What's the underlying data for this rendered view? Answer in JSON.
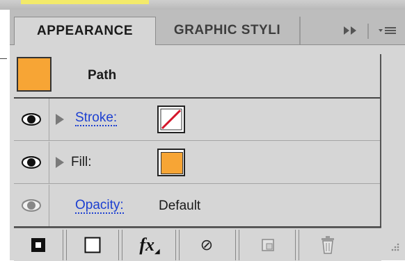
{
  "tabs": [
    {
      "label": "APPEARANCE",
      "active": true
    },
    {
      "label": "GRAPHIC STYLI",
      "active": false
    }
  ],
  "header_controls": {
    "more_glyph": "▸▸",
    "menu_glyph": "▾≡"
  },
  "path": {
    "label": "Path",
    "swatch_color": "#f7a535"
  },
  "attributes": [
    {
      "name": "stroke",
      "label": "Stroke:",
      "link": true,
      "value_icon": "none-swatch-icon"
    },
    {
      "name": "fill",
      "label": "Fill:",
      "link": false,
      "swatch_color": "#f7a535"
    },
    {
      "name": "opacity",
      "label": "Opacity:",
      "link": true,
      "value": "Default"
    }
  ],
  "toolbar": {
    "buttons": [
      {
        "name": "add-new-stroke-button",
        "icon": "filled-square-icon"
      },
      {
        "name": "add-new-fill-button",
        "icon": "empty-square-icon"
      },
      {
        "name": "add-new-effect-button",
        "icon": "fx-icon",
        "glyph": "fx"
      },
      {
        "name": "clear-appearance-button",
        "icon": "no-symbol-icon",
        "glyph": "⊘"
      },
      {
        "name": "duplicate-item-button",
        "icon": "duplicate-icon"
      },
      {
        "name": "delete-item-button",
        "icon": "trash-icon"
      }
    ]
  },
  "colors": {
    "accent_link": "#1c3fd1",
    "orange": "#f7a535",
    "panel_bg": "#d6d6d6"
  }
}
